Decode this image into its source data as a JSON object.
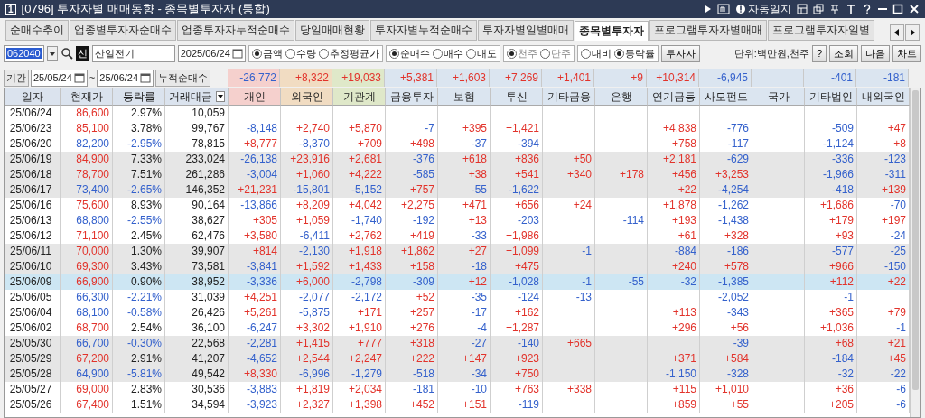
{
  "title_bar": {
    "number": "1",
    "title": "[0796] 투자자별 매매동향 - 종목별투자자 (통합)",
    "auto_log": "자동일지"
  },
  "tabs": [
    {
      "label": "순매수추이",
      "selected": false
    },
    {
      "label": "업종별투자자순매수",
      "selected": false
    },
    {
      "label": "업종투자자누적순매수",
      "selected": false
    },
    {
      "label": "당일매매현황",
      "selected": false
    },
    {
      "label": "투자자별누적순매수",
      "selected": false
    },
    {
      "label": "투자자별일별매매",
      "selected": false
    },
    {
      "label": "종목별투자자",
      "selected": true
    },
    {
      "label": "프로그램투자자별매매",
      "selected": false
    },
    {
      "label": "프로그램투자자일별",
      "selected": false
    }
  ],
  "search": {
    "code": "062040",
    "badge": "신",
    "name": "산일전기",
    "date": "2025/06/24"
  },
  "radio_groups": [
    {
      "options": [
        {
          "label": "금액",
          "selected": true,
          "disabled": false
        },
        {
          "label": "수량",
          "selected": false,
          "disabled": false
        },
        {
          "label": "추정평균가",
          "selected": false,
          "disabled": false
        }
      ]
    },
    {
      "options": [
        {
          "label": "순매수",
          "selected": true,
          "disabled": false
        },
        {
          "label": "매수",
          "selected": false,
          "disabled": false
        },
        {
          "label": "매도",
          "selected": false,
          "disabled": false
        }
      ]
    },
    {
      "options": [
        {
          "label": "천주",
          "selected": true,
          "disabled": true
        },
        {
          "label": "단주",
          "selected": false,
          "disabled": true
        }
      ]
    },
    {
      "options": [
        {
          "label": "대비",
          "selected": false,
          "disabled": false
        },
        {
          "label": "등락률",
          "selected": true,
          "disabled": false
        }
      ]
    }
  ],
  "investor_button": "투자자",
  "unit": "단위:백만원,천주",
  "buttons": [
    "?",
    "조회",
    "다음",
    "차트"
  ],
  "period": {
    "label": "기간",
    "from": "25/05/24",
    "separator": "~",
    "to": "25/06/24",
    "summary_label": "누적순매수",
    "totals": [
      {
        "value": "-26,772"
      },
      {
        "value": "+8,322"
      },
      {
        "value": "+19,033"
      },
      {
        "value": "+5,381"
      },
      {
        "value": "+1,603"
      },
      {
        "value": "+7,269"
      },
      {
        "value": "+1,401"
      },
      {
        "value": "+9"
      },
      {
        "value": "+10,314"
      },
      {
        "value": "-6,945"
      },
      {
        "blank": true
      },
      {
        "value": "-401"
      },
      {
        "value": "-181"
      }
    ]
  },
  "table": {
    "columns": [
      {
        "label": "일자",
        "kind": "base"
      },
      {
        "label": "현재가",
        "kind": "base"
      },
      {
        "label": "등락률",
        "kind": "base"
      },
      {
        "label": "거래대금",
        "kind": "base"
      },
      {
        "label": "개인",
        "kind": "individual"
      },
      {
        "label": "외국인",
        "kind": "foreign"
      },
      {
        "label": "기관계",
        "kind": "institution"
      },
      {
        "label": "금융투자",
        "kind": "other"
      },
      {
        "label": "보험",
        "kind": "other"
      },
      {
        "label": "투신",
        "kind": "other"
      },
      {
        "label": "기타금융",
        "kind": "other"
      },
      {
        "label": "은행",
        "kind": "other"
      },
      {
        "label": "연기금등",
        "kind": "other"
      },
      {
        "label": "사모펀드",
        "kind": "other"
      },
      {
        "label": "국가",
        "kind": "other"
      },
      {
        "label": "기타법인",
        "kind": "other"
      },
      {
        "label": "내외국인",
        "kind": "other"
      }
    ],
    "rows": [
      {
        "shaded": false,
        "selected": false,
        "cells": [
          "25/06/24",
          "86,600",
          "2.97%",
          "10,059",
          null,
          null,
          null,
          null,
          null,
          null,
          null,
          null,
          null,
          null,
          null,
          null,
          null
        ]
      },
      {
        "shaded": false,
        "selected": false,
        "cells": [
          "25/06/23",
          "85,100",
          "3.78%",
          "99,767",
          "-8,148",
          "+2,740",
          "+5,870",
          "-7",
          "+395",
          "+1,421",
          null,
          null,
          "+4,838",
          "-776",
          null,
          "-509",
          "+47"
        ]
      },
      {
        "shaded": false,
        "selected": false,
        "cells": [
          "25/06/20",
          "82,200",
          "-2.95%",
          "78,815",
          "+8,777",
          "-8,370",
          "+709",
          "+498",
          "-37",
          "-394",
          null,
          null,
          "+758",
          "-117",
          null,
          "-1,124",
          "+8"
        ]
      },
      {
        "shaded": true,
        "selected": false,
        "cells": [
          "25/06/19",
          "84,900",
          "7.33%",
          "233,024",
          "-26,138",
          "+23,916",
          "+2,681",
          "-376",
          "+618",
          "+836",
          "+50",
          null,
          "+2,181",
          "-629",
          null,
          "-336",
          "-123"
        ]
      },
      {
        "shaded": true,
        "selected": false,
        "cells": [
          "25/06/18",
          "78,700",
          "7.51%",
          "261,286",
          "-3,004",
          "+1,060",
          "+4,222",
          "-585",
          "+38",
          "+541",
          "+340",
          "+178",
          "+456",
          "+3,253",
          null,
          "-1,966",
          "-311"
        ]
      },
      {
        "shaded": true,
        "selected": false,
        "cells": [
          "25/06/17",
          "73,400",
          "-2.65%",
          "146,352",
          "+21,231",
          "-15,801",
          "-5,152",
          "+757",
          "-55",
          "-1,622",
          null,
          null,
          "+22",
          "-4,254",
          null,
          "-418",
          "+139"
        ]
      },
      {
        "shaded": false,
        "selected": false,
        "cells": [
          "25/06/16",
          "75,600",
          "8.93%",
          "90,164",
          "-13,866",
          "+8,209",
          "+4,042",
          "+2,275",
          "+471",
          "+656",
          "+24",
          null,
          "+1,878",
          "-1,262",
          null,
          "+1,686",
          "-70"
        ]
      },
      {
        "shaded": false,
        "selected": false,
        "cells": [
          "25/06/13",
          "68,800",
          "-2.55%",
          "38,627",
          "+305",
          "+1,059",
          "-1,740",
          "-192",
          "+13",
          "-203",
          null,
          "-114",
          "+193",
          "-1,438",
          null,
          "+179",
          "+197"
        ]
      },
      {
        "shaded": false,
        "selected": false,
        "cells": [
          "25/06/12",
          "71,100",
          "2.45%",
          "62,476",
          "+3,580",
          "-6,411",
          "+2,762",
          "+419",
          "-33",
          "+1,986",
          null,
          null,
          "+61",
          "+328",
          null,
          "+93",
          "-24"
        ]
      },
      {
        "shaded": true,
        "selected": false,
        "cells": [
          "25/06/11",
          "70,000",
          "1.30%",
          "39,907",
          "+814",
          "-2,130",
          "+1,918",
          "+1,862",
          "+27",
          "+1,099",
          "-1",
          null,
          "-884",
          "-186",
          null,
          "-577",
          "-25"
        ]
      },
      {
        "shaded": true,
        "selected": false,
        "cells": [
          "25/06/10",
          "69,300",
          "3.43%",
          "73,581",
          "-3,841",
          "+1,592",
          "+1,433",
          "+158",
          "-18",
          "+475",
          null,
          null,
          "+240",
          "+578",
          null,
          "+966",
          "-150"
        ]
      },
      {
        "shaded": true,
        "selected": true,
        "cells": [
          "25/06/09",
          "66,900",
          "0.90%",
          "38,952",
          "-3,336",
          "+6,000",
          "-2,798",
          "-309",
          "+12",
          "-1,028",
          "-1",
          "-55",
          "-32",
          "-1,385",
          null,
          "+112",
          "+22"
        ]
      },
      {
        "shaded": false,
        "selected": false,
        "cells": [
          "25/06/05",
          "66,300",
          "-2.21%",
          "31,039",
          "+4,251",
          "-2,077",
          "-2,172",
          "+52",
          "-35",
          "-124",
          "-13",
          null,
          null,
          "-2,052",
          null,
          "-1",
          null
        ]
      },
      {
        "shaded": false,
        "selected": false,
        "cells": [
          "25/06/04",
          "68,100",
          "-0.58%",
          "26,426",
          "+5,261",
          "-5,875",
          "+171",
          "+257",
          "-17",
          "+162",
          null,
          null,
          "+113",
          "-343",
          null,
          "+365",
          "+79"
        ]
      },
      {
        "shaded": false,
        "selected": false,
        "cells": [
          "25/06/02",
          "68,700",
          "2.54%",
          "36,100",
          "-6,247",
          "+3,302",
          "+1,910",
          "+276",
          "-4",
          "+1,287",
          null,
          null,
          "+296",
          "+56",
          null,
          "+1,036",
          "-1"
        ]
      },
      {
        "shaded": true,
        "selected": false,
        "cells": [
          "25/05/30",
          "66,700",
          "-0.30%",
          "22,568",
          "-2,281",
          "+1,415",
          "+777",
          "+318",
          "-27",
          "-140",
          "+665",
          null,
          null,
          "-39",
          null,
          "+68",
          "+21"
        ]
      },
      {
        "shaded": true,
        "selected": false,
        "cells": [
          "25/05/29",
          "67,200",
          "2.91%",
          "41,207",
          "-4,652",
          "+2,544",
          "+2,247",
          "+222",
          "+147",
          "+923",
          null,
          null,
          "+371",
          "+584",
          null,
          "-184",
          "+45"
        ]
      },
      {
        "shaded": true,
        "selected": false,
        "cells": [
          "25/05/28",
          "64,900",
          "-5.81%",
          "49,542",
          "+8,330",
          "-6,996",
          "-1,279",
          "-518",
          "-34",
          "+750",
          null,
          null,
          "-1,150",
          "-328",
          null,
          "-32",
          "-22"
        ]
      },
      {
        "shaded": false,
        "selected": false,
        "cells": [
          "25/05/27",
          "69,000",
          "2.83%",
          "30,536",
          "-3,883",
          "+1,819",
          "+2,034",
          "-181",
          "-10",
          "+763",
          "+338",
          null,
          "+115",
          "+1,010",
          null,
          "+36",
          "-6"
        ]
      },
      {
        "shaded": false,
        "selected": false,
        "cells": [
          "25/05/26",
          "67,400",
          "1.51%",
          "34,594",
          "-3,923",
          "+2,327",
          "+1,398",
          "+452",
          "+151",
          "-119",
          null,
          null,
          "+859",
          "+55",
          null,
          "+205",
          "-6"
        ]
      }
    ]
  }
}
